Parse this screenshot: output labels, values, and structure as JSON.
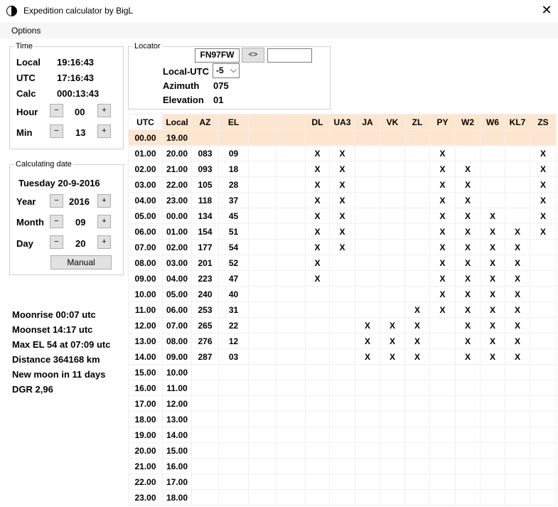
{
  "window": {
    "title": "Expedition calculator by BigL",
    "close_glyph": "✕"
  },
  "menu": {
    "options": "Options"
  },
  "time": {
    "legend": "Time",
    "local_label": "Local",
    "local_value": "19:16:43",
    "utc_label": "UTC",
    "utc_value": "17:16:43",
    "calc_label": "Calc",
    "calc_value": "000:13:43",
    "hour_label": "Hour",
    "hour_value": "00",
    "min_label": "Min",
    "min_value": "13",
    "minus": "−",
    "plus": "+"
  },
  "calc_date": {
    "legend": "Calculating date",
    "date_text": "Tuesday 20-9-2016",
    "year_label": "Year",
    "year_value": "2016",
    "month_label": "Month",
    "month_value": "09",
    "day_label": "Day",
    "day_value": "20",
    "manual_button": "Manual"
  },
  "locator": {
    "legend": "Locator",
    "value": "FN97FW",
    "swap_button": "<>",
    "second_value": "",
    "local_utc_label": "Local-UTC",
    "local_utc_value": "-5",
    "azimuth_label": "Azimuth",
    "azimuth_value": "075",
    "elevation_label": "Elevation",
    "elevation_value": "01"
  },
  "moon_info": {
    "moonrise": "Moonrise 00:07 utc",
    "moonset": "Moonset 14:17 utc",
    "max_el": "Max EL 54 at 07:09 utc",
    "distance": "Distance 364168 km",
    "new_moon": "New moon in 11 days",
    "dgr": "DGR 2,96"
  },
  "table": {
    "headers": [
      "UTC",
      "Local",
      "AZ",
      "EL",
      "",
      "",
      "DL",
      "UA3",
      "JA",
      "VK",
      "ZL",
      "PY",
      "W2",
      "W6",
      "KL7",
      "ZS"
    ],
    "rows": [
      [
        "00.00",
        "19.00",
        "",
        "",
        "",
        "",
        "",
        "",
        "",
        "",
        "",
        "",
        "",
        "",
        "",
        ""
      ],
      [
        "01.00",
        "20.00",
        "083",
        "09",
        "",
        "",
        "X",
        "X",
        "",
        "",
        "",
        "X",
        "",
        "",
        "",
        "X"
      ],
      [
        "02.00",
        "21.00",
        "093",
        "18",
        "",
        "",
        "X",
        "X",
        "",
        "",
        "",
        "X",
        "X",
        "",
        "",
        "X"
      ],
      [
        "03.00",
        "22.00",
        "105",
        "28",
        "",
        "",
        "X",
        "X",
        "",
        "",
        "",
        "X",
        "X",
        "",
        "",
        "X"
      ],
      [
        "04.00",
        "23.00",
        "118",
        "37",
        "",
        "",
        "X",
        "X",
        "",
        "",
        "",
        "X",
        "X",
        "",
        "",
        "X"
      ],
      [
        "05.00",
        "00.00",
        "134",
        "45",
        "",
        "",
        "X",
        "X",
        "",
        "",
        "",
        "X",
        "X",
        "X",
        "",
        "X"
      ],
      [
        "06.00",
        "01.00",
        "154",
        "51",
        "",
        "",
        "X",
        "X",
        "",
        "",
        "",
        "X",
        "X",
        "X",
        "X",
        "X"
      ],
      [
        "07.00",
        "02.00",
        "177",
        "54",
        "",
        "",
        "X",
        "X",
        "",
        "",
        "",
        "X",
        "X",
        "X",
        "X",
        ""
      ],
      [
        "08.00",
        "03.00",
        "201",
        "52",
        "",
        "",
        "X",
        "",
        "",
        "",
        "",
        "X",
        "X",
        "X",
        "X",
        ""
      ],
      [
        "09.00",
        "04.00",
        "223",
        "47",
        "",
        "",
        "X",
        "",
        "",
        "",
        "",
        "X",
        "X",
        "X",
        "X",
        ""
      ],
      [
        "10.00",
        "05.00",
        "240",
        "40",
        "",
        "",
        "",
        "",
        "",
        "",
        "",
        "X",
        "X",
        "X",
        "X",
        ""
      ],
      [
        "11.00",
        "06.00",
        "253",
        "31",
        "",
        "",
        "",
        "",
        "",
        "",
        "X",
        "X",
        "X",
        "X",
        "X",
        ""
      ],
      [
        "12.00",
        "07.00",
        "265",
        "22",
        "",
        "",
        "",
        "",
        "X",
        "X",
        "X",
        "",
        "X",
        "X",
        "X",
        ""
      ],
      [
        "13.00",
        "08.00",
        "276",
        "12",
        "",
        "",
        "",
        "",
        "X",
        "X",
        "X",
        "",
        "X",
        "X",
        "X",
        ""
      ],
      [
        "14.00",
        "09.00",
        "287",
        "03",
        "",
        "",
        "",
        "",
        "X",
        "X",
        "X",
        "",
        "X",
        "X",
        "X",
        ""
      ],
      [
        "15.00",
        "10.00",
        "",
        "",
        "",
        "",
        "",
        "",
        "",
        "",
        "",
        "",
        "",
        "",
        "",
        ""
      ],
      [
        "16.00",
        "11.00",
        "",
        "",
        "",
        "",
        "",
        "",
        "",
        "",
        "",
        "",
        "",
        "",
        "",
        ""
      ],
      [
        "17.00",
        "12.00",
        "",
        "",
        "",
        "",
        "",
        "",
        "",
        "",
        "",
        "",
        "",
        "",
        "",
        ""
      ],
      [
        "18.00",
        "13.00",
        "",
        "",
        "",
        "",
        "",
        "",
        "",
        "",
        "",
        "",
        "",
        "",
        "",
        ""
      ],
      [
        "19.00",
        "14.00",
        "",
        "",
        "",
        "",
        "",
        "",
        "",
        "",
        "",
        "",
        "",
        "",
        "",
        ""
      ],
      [
        "20.00",
        "15.00",
        "",
        "",
        "",
        "",
        "",
        "",
        "",
        "",
        "",
        "",
        "",
        "",
        "",
        ""
      ],
      [
        "21.00",
        "16.00",
        "",
        "",
        "",
        "",
        "",
        "",
        "",
        "",
        "",
        "",
        "",
        "",
        "",
        ""
      ],
      [
        "22.00",
        "17.00",
        "",
        "",
        "",
        "",
        "",
        "",
        "",
        "",
        "",
        "",
        "",
        "",
        "",
        ""
      ],
      [
        "23.00",
        "18.00",
        "",
        "",
        "",
        "",
        "",
        "",
        "",
        "",
        "",
        "",
        "",
        "",
        "",
        ""
      ]
    ],
    "highlight_color": "#fde6cf"
  }
}
